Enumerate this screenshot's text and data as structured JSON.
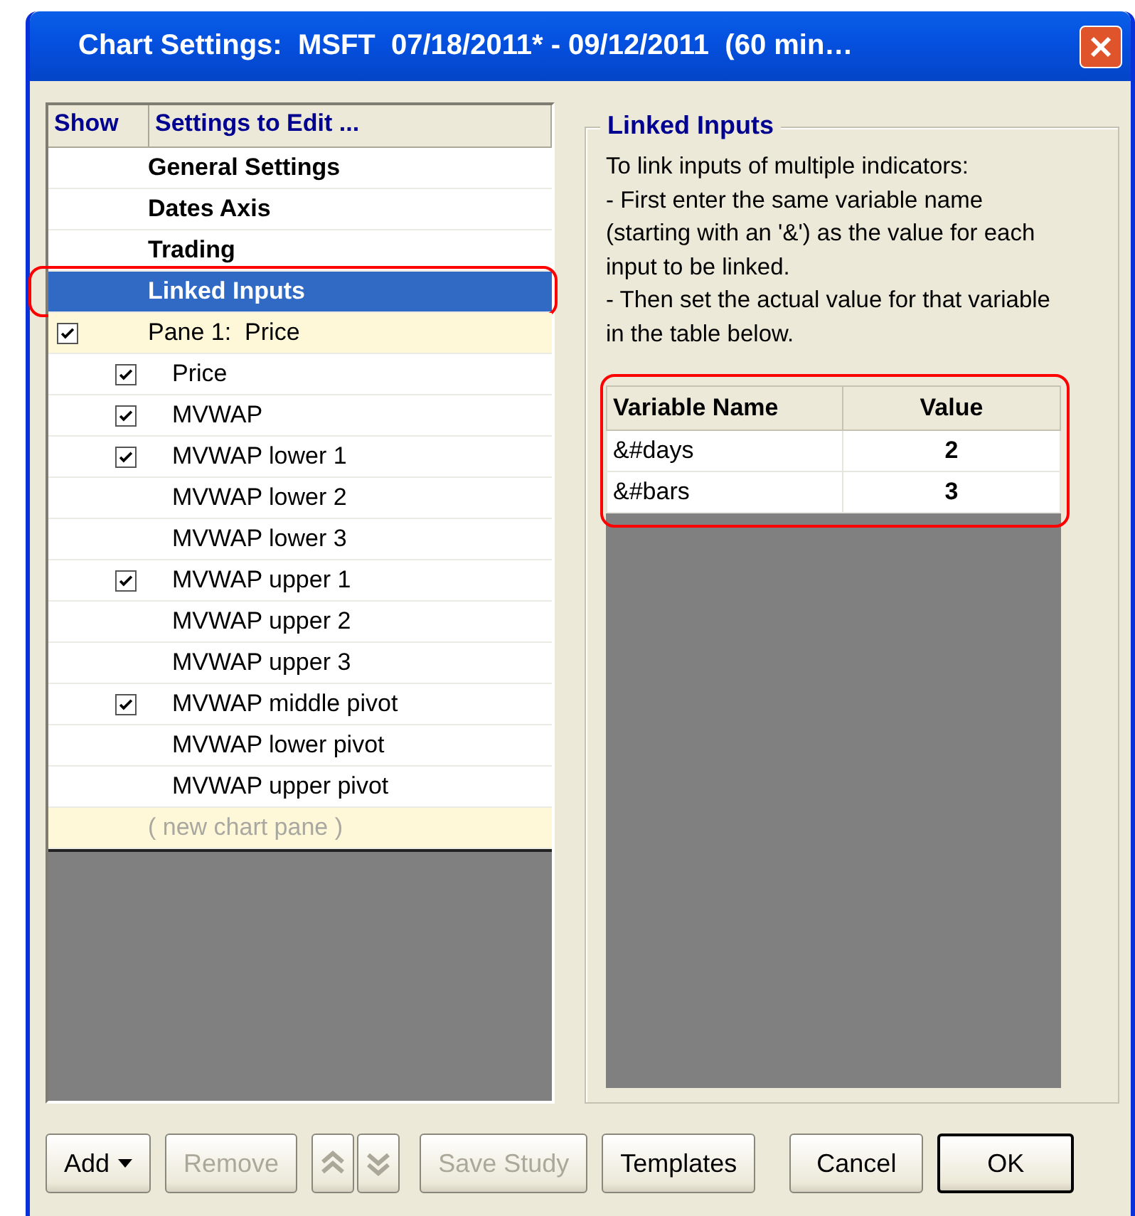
{
  "window": {
    "title": "Chart Settings:  MSFT  07/18/2011* - 09/12/2011  (60 min…"
  },
  "settings_list": {
    "columns": [
      "Show",
      "Settings to Edit ..."
    ],
    "items": [
      {
        "label": "General Settings",
        "kind": "section",
        "selected": false,
        "highlighted": false
      },
      {
        "label": "Dates Axis",
        "kind": "section",
        "selected": false,
        "highlighted": false
      },
      {
        "label": "Trading",
        "kind": "section",
        "selected": false,
        "highlighted": false
      },
      {
        "label": "Linked Inputs",
        "kind": "section",
        "selected": true,
        "highlighted": true
      },
      {
        "label": "Pane 1:  Price",
        "kind": "pane",
        "checked": true,
        "selected": false,
        "highlighted": false,
        "children": [
          {
            "label": "Price",
            "checked": true,
            "selected": false
          },
          {
            "label": "MVWAP",
            "checked": true,
            "selected": false
          },
          {
            "label": "MVWAP lower 1",
            "checked": true,
            "selected": false
          },
          {
            "label": "MVWAP lower 2",
            "checked": false,
            "selected": false
          },
          {
            "label": "MVWAP lower 3",
            "checked": false,
            "selected": false
          },
          {
            "label": "MVWAP upper 1",
            "checked": true,
            "selected": false
          },
          {
            "label": "MVWAP upper 2",
            "checked": false,
            "selected": false
          },
          {
            "label": "MVWAP upper 3",
            "checked": false,
            "selected": false
          },
          {
            "label": "MVWAP middle pivot",
            "checked": true,
            "selected": false
          },
          {
            "label": "MVWAP lower pivot",
            "checked": false,
            "selected": false
          },
          {
            "label": "MVWAP upper pivot",
            "checked": false,
            "selected": false
          }
        ]
      },
      {
        "label": "( new chart pane )",
        "kind": "new_pane",
        "selected": false,
        "highlighted": false
      }
    ]
  },
  "linked_inputs": {
    "title": "Linked Inputs",
    "instructions": [
      "To link inputs of multiple indicators:",
      "- First enter the same variable name (starting with an '&') as the value for each input to be linked.",
      "- Then set the actual value for that variable in the table below."
    ],
    "table": {
      "highlighted": true,
      "columns": [
        "Variable Name",
        "Value"
      ],
      "rows": [
        [
          "&#days",
          "2"
        ],
        [
          "&#bars",
          "3"
        ]
      ]
    }
  },
  "buttons": [
    {
      "label": "Add",
      "kind": "dropdown",
      "disabled": false
    },
    {
      "label": "Remove",
      "kind": "plain",
      "disabled": true
    },
    {
      "kind": "move_up",
      "disabled": true
    },
    {
      "kind": "move_down",
      "disabled": true
    },
    {
      "label": "Save Study",
      "kind": "plain",
      "disabled": true
    },
    {
      "label": "Templates",
      "kind": "plain",
      "disabled": false
    },
    {
      "label": "Cancel",
      "kind": "plain",
      "disabled": false
    },
    {
      "label": "OK",
      "kind": "default",
      "disabled": false
    }
  ]
}
